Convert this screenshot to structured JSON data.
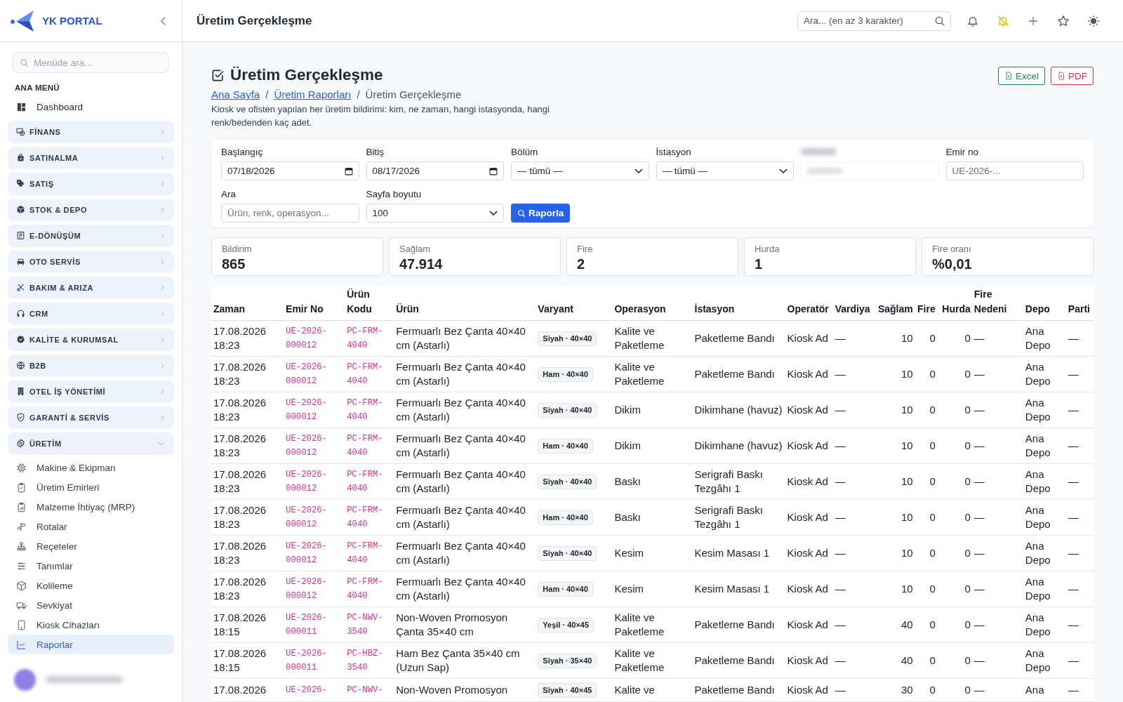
{
  "sidebar": {
    "brand": "YK PORTAL",
    "search": {
      "placeholder": "Menüde ara..."
    },
    "section_title": "ANA MENÜ",
    "items": [
      {
        "label": "Dashboard",
        "kind": "link",
        "selected": false
      },
      {
        "label": "FİNANS",
        "kind": "group",
        "expanded": false
      },
      {
        "label": "SATINALMA",
        "kind": "group",
        "expanded": false
      },
      {
        "label": "SATIŞ",
        "kind": "group",
        "expanded": false
      },
      {
        "label": "STOK & DEPO",
        "kind": "group",
        "expanded": false
      },
      {
        "label": "E-DÖNÜŞÜM",
        "kind": "group",
        "expanded": false
      },
      {
        "label": "OTO SERVİS",
        "kind": "group",
        "expanded": false
      },
      {
        "label": "BAKIM & ARIZA",
        "kind": "group",
        "expanded": false
      },
      {
        "label": "CRM",
        "kind": "group",
        "expanded": false
      },
      {
        "label": "KALİTE & KURUMSAL",
        "kind": "group",
        "expanded": false
      },
      {
        "label": "B2B",
        "kind": "group",
        "expanded": false
      },
      {
        "label": "OTEL İŞ YÖNETİMİ",
        "kind": "group",
        "expanded": false
      },
      {
        "label": "GARANTİ & SERVİS",
        "kind": "group",
        "expanded": false
      },
      {
        "label": "ÜRETİM",
        "kind": "group",
        "expanded": true,
        "children": [
          {
            "label": "Makine & Ekipman",
            "selected": false
          },
          {
            "label": "Üretim Emirleri",
            "selected": false
          },
          {
            "label": "Malzeme İhtiyaç (MRP)",
            "selected": false
          },
          {
            "label": "Rotalar",
            "selected": false
          },
          {
            "label": "Reçeteler",
            "selected": false
          },
          {
            "label": "Tanımlar",
            "selected": false
          },
          {
            "label": "Kolileme",
            "selected": false
          },
          {
            "label": "Sevkiyat",
            "selected": false
          },
          {
            "label": "Kiosk Cihazları",
            "selected": false
          },
          {
            "label": "Raporlar",
            "selected": true
          }
        ]
      }
    ]
  },
  "topbar": {
    "title": "Üretim Gerçekleşme",
    "search": {
      "placeholder": "Ara... (en az 3 karakter)"
    }
  },
  "page": {
    "title": "Üretim Gerçekleşme",
    "breadcrumb": [
      {
        "kind": "link",
        "label": "Ana Sayfa"
      },
      {
        "kind": "separator",
        "label": "/"
      },
      {
        "kind": "link",
        "label": "Üretim Raporları"
      },
      {
        "kind": "separator",
        "label": "/"
      },
      {
        "kind": "current",
        "label": "Üretim Gerçekleşme"
      }
    ],
    "description": "Kiosk ve ofisten yapılan her üretim bildirimi: kim, ne zaman, hangi istasyonda, hangi renk/bedenden kaç adet.",
    "export_buttons": [
      {
        "label": "Excel",
        "kind": "excel"
      },
      {
        "label": "PDF",
        "kind": "pdf"
      }
    ]
  },
  "filters": {
    "fields": [
      {
        "label": "Başlangıç",
        "kind": "date",
        "value": "07/18/2026"
      },
      {
        "label": "Bitiş",
        "kind": "date",
        "value": "08/17/2026"
      },
      {
        "label": "Bölüm",
        "kind": "select",
        "value": "— tümü —"
      },
      {
        "label": "İstasyon",
        "kind": "select",
        "value": "— tümü —"
      },
      {
        "kind": "blurred"
      },
      {
        "label": "Emir no",
        "kind": "text",
        "placeholder": "UE-2026-..."
      },
      {
        "label": "Ara",
        "kind": "text",
        "placeholder": "Ürün, renk, operasyon..."
      },
      {
        "label": "Sayfa boyutu",
        "kind": "select",
        "value": "100"
      }
    ],
    "submit": "Raporla"
  },
  "stats": [
    {
      "label": "Bildirim",
      "value": "865"
    },
    {
      "label": "Sağlam",
      "value": "47.914"
    },
    {
      "label": "Fire",
      "value": "2"
    },
    {
      "label": "Hurda",
      "value": "1"
    },
    {
      "label": "Fire oranı",
      "value": "%0,01"
    }
  ],
  "table": {
    "columns": [
      {
        "label": "Zaman",
        "kind": "text"
      },
      {
        "label": "Emir No",
        "kind": "code"
      },
      {
        "label": "Ürün Kodu",
        "kind": "code"
      },
      {
        "label": "Ürün",
        "kind": "text"
      },
      {
        "label": "Varyant",
        "kind": "badge"
      },
      {
        "label": "Operasyon",
        "kind": "text"
      },
      {
        "label": "İstasyon",
        "kind": "text"
      },
      {
        "label": "Operatör",
        "kind": "text"
      },
      {
        "label": "Vardiya",
        "kind": "text"
      },
      {
        "label": "Sağlam",
        "kind": "number"
      },
      {
        "label": "Fire",
        "kind": "number"
      },
      {
        "label": "Hurda",
        "kind": "number"
      },
      {
        "label": "Fire Nedeni",
        "kind": "text"
      },
      {
        "label": "Depo",
        "kind": "text"
      },
      {
        "label": "Parti",
        "kind": "text"
      }
    ],
    "rows": [
      [
        "17.08.2026 18:23",
        "UE-2026-000012",
        "PC-FRM-4040",
        "Fermuarlı Bez Çanta 40×40 cm (Astarlı)",
        "Siyah · 40×40",
        "Kalite ve Paketleme",
        "Paketleme Bandı",
        "Kiosk Ad",
        "—",
        "10",
        "0",
        "0",
        "—",
        "Ana Depo",
        "—"
      ],
      [
        "17.08.2026 18:23",
        "UE-2026-000012",
        "PC-FRM-4040",
        "Fermuarlı Bez Çanta 40×40 cm (Astarlı)",
        "Ham · 40×40",
        "Kalite ve Paketleme",
        "Paketleme Bandı",
        "Kiosk Ad",
        "—",
        "10",
        "0",
        "0",
        "—",
        "Ana Depo",
        "—"
      ],
      [
        "17.08.2026 18:23",
        "UE-2026-000012",
        "PC-FRM-4040",
        "Fermuarlı Bez Çanta 40×40 cm (Astarlı)",
        "Siyah · 40×40",
        "Dikim",
        "Dikimhane (havuz)",
        "Kiosk Ad",
        "—",
        "10",
        "0",
        "0",
        "—",
        "Ana Depo",
        "—"
      ],
      [
        "17.08.2026 18:23",
        "UE-2026-000012",
        "PC-FRM-4040",
        "Fermuarlı Bez Çanta 40×40 cm (Astarlı)",
        "Ham · 40×40",
        "Dikim",
        "Dikimhane (havuz)",
        "Kiosk Ad",
        "—",
        "10",
        "0",
        "0",
        "—",
        "Ana Depo",
        "—"
      ],
      [
        "17.08.2026 18:23",
        "UE-2026-000012",
        "PC-FRM-4040",
        "Fermuarlı Bez Çanta 40×40 cm (Astarlı)",
        "Siyah · 40×40",
        "Baskı",
        "Serigrafi Baskı Tezgâhı 1",
        "Kiosk Ad",
        "—",
        "10",
        "0",
        "0",
        "—",
        "Ana Depo",
        "—"
      ],
      [
        "17.08.2026 18:23",
        "UE-2026-000012",
        "PC-FRM-4040",
        "Fermuarlı Bez Çanta 40×40 cm (Astarlı)",
        "Ham · 40×40",
        "Baskı",
        "Serigrafi Baskı Tezgâhı 1",
        "Kiosk Ad",
        "—",
        "10",
        "0",
        "0",
        "—",
        "Ana Depo",
        "—"
      ],
      [
        "17.08.2026 18:23",
        "UE-2026-000012",
        "PC-FRM-4040",
        "Fermuarlı Bez Çanta 40×40 cm (Astarlı)",
        "Siyah · 40×40",
        "Kesim",
        "Kesim Masası 1",
        "Kiosk Ad",
        "—",
        "10",
        "0",
        "0",
        "—",
        "Ana Depo",
        "—"
      ],
      [
        "17.08.2026 18:23",
        "UE-2026-000012",
        "PC-FRM-4040",
        "Fermuarlı Bez Çanta 40×40 cm (Astarlı)",
        "Ham · 40×40",
        "Kesim",
        "Kesim Masası 1",
        "Kiosk Ad",
        "—",
        "10",
        "0",
        "0",
        "—",
        "Ana Depo",
        "—"
      ],
      [
        "17.08.2026 18:15",
        "UE-2026-000011",
        "PC-NWV-3540",
        "Non-Woven Promosyon Çanta 35×40 cm",
        "Yeşil · 40×45",
        "Kalite ve Paketleme",
        "Paketleme Bandı",
        "Kiosk Ad",
        "—",
        "40",
        "0",
        "0",
        "—",
        "Ana Depo",
        "—"
      ],
      [
        "17.08.2026 18:15",
        "UE-2026-000011",
        "PC-HBZ-3540",
        "Ham Bez Çanta 35×40 cm (Uzun Sap)",
        "Siyah · 35×40",
        "Kalite ve Paketleme",
        "Paketleme Bandı",
        "Kiosk Ad",
        "—",
        "40",
        "0",
        "0",
        "—",
        "Ana Depo",
        "—"
      ],
      [
        "17.08.2026",
        "UE-2026-",
        "PC-NWV-",
        "Non-Woven Promosyon",
        "Siyah · 40×45",
        "Kalite ve",
        "Paketleme Bandı",
        "Kiosk Ad",
        "—",
        "30",
        "0",
        "0",
        "—",
        "Ana",
        "—"
      ]
    ]
  }
}
